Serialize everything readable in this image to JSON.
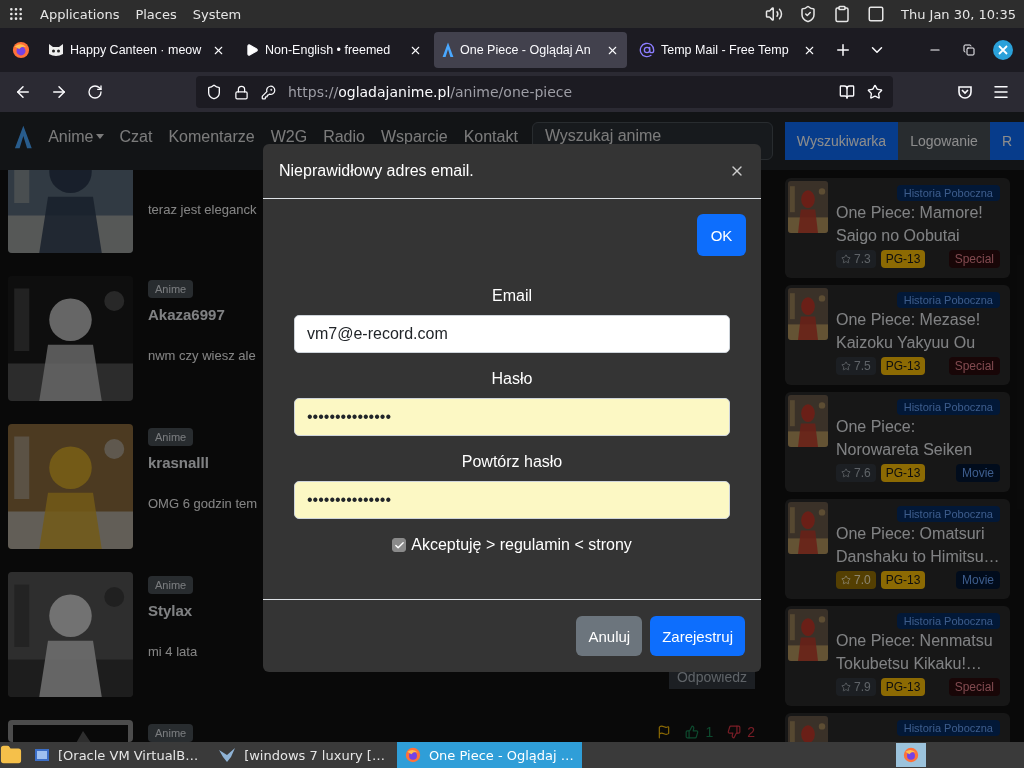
{
  "system_bar": {
    "menus": [
      "Applications",
      "Places",
      "System"
    ],
    "clock": "Thu Jan 30, 10:35"
  },
  "browser": {
    "tabs": [
      {
        "title": "Happy Canteen · meow",
        "selected": false
      },
      {
        "title": "Non-English • freemed",
        "selected": false
      },
      {
        "title": "One Piece - Oglądaj An",
        "selected": true
      },
      {
        "title": "Temp Mail - Free Temp",
        "selected": false
      }
    ],
    "url": {
      "scheme": "https://",
      "host": "ogladajanime.pl",
      "path": "/anime/one-piece"
    }
  },
  "site": {
    "nav": [
      {
        "label": "Anime",
        "dropdown": true
      },
      {
        "label": "Czat",
        "dropdown": false
      },
      {
        "label": "Komentarze",
        "dropdown": false
      },
      {
        "label": "W2G",
        "dropdown": false
      },
      {
        "label": "Radio",
        "dropdown": false
      },
      {
        "label": "Wsparcie",
        "dropdown": false
      },
      {
        "label": "Kontakt",
        "dropdown": false
      }
    ],
    "search": {
      "placeholder": "Wyszukaj anime"
    },
    "nav_buttons": [
      {
        "label": "Wyszukiwarka",
        "kind": "primary"
      },
      {
        "label": "Logowanie",
        "kind": "secondary"
      },
      {
        "label": "R",
        "kind": "primary"
      }
    ],
    "comments": [
      {
        "text": "teraz jest eleganck"
      },
      {
        "badge": "Anime",
        "user": "Akaza6997",
        "text": "nwm czy wiesz ale"
      },
      {
        "badge": "Anime",
        "user": "krasnalll",
        "text": "OMG 6 godzin tem"
      },
      {
        "badge": "Anime",
        "user": "Stylax",
        "text": "mi 4 lata",
        "reply": "Odpowiedz"
      },
      {
        "badge": "Anime",
        "reactions": [
          {
            "kind": "flag"
          },
          {
            "kind": "up",
            "count": "1"
          },
          {
            "kind": "down",
            "count": "2"
          }
        ]
      }
    ],
    "related": [
      {
        "badge": "Historia Poboczna",
        "title": "One Piece: Mamore! Saigo no Oobutai",
        "rating": "7.3",
        "rating_highlight": false,
        "age": "PG-13",
        "type": "Special",
        "kind": "special"
      },
      {
        "badge": "Historia Poboczna",
        "title": "One Piece: Mezase! Kaizoku Yakyuu Ou",
        "rating": "7.5",
        "rating_highlight": false,
        "age": "PG-13",
        "type": "Special",
        "kind": "special"
      },
      {
        "badge": "Historia Poboczna",
        "title": "One Piece: Norowareta Seiken",
        "rating": "7.6",
        "rating_highlight": false,
        "age": "PG-13",
        "type": "Movie",
        "kind": "movie"
      },
      {
        "badge": "Historia Poboczna",
        "title": "One Piece: Omatsuri Danshaku to Himitsu…",
        "rating": "7.0",
        "rating_highlight": true,
        "age": "PG-13",
        "type": "Movie",
        "kind": "movie"
      },
      {
        "badge": "Historia Poboczna",
        "title": "One Piece: Nenmatsu Tokubetsu Kikaku!…",
        "rating": "7.9",
        "rating_highlight": false,
        "age": "PG-13",
        "type": "Special",
        "kind": "special"
      },
      {
        "badge": "Historia Poboczna"
      }
    ]
  },
  "modal": {
    "title": "Nieprawidłowy adres email.",
    "ok": "OK",
    "fields": [
      {
        "label": "Email",
        "value": "vm7@e-record.com",
        "autofilled": false
      },
      {
        "label": "Hasło",
        "value": "•••••••••••••••",
        "autofilled": true
      },
      {
        "label": "Powtórz hasło",
        "value": "•••••••••••••••",
        "autofilled": true
      }
    ],
    "accept": {
      "label": "Akceptuję > regulamin < strony",
      "checked": true
    },
    "buttons": [
      {
        "label": "Anuluj",
        "kind": "secondary"
      },
      {
        "label": "Zarejestruj",
        "kind": "primary"
      }
    ]
  },
  "taskbar": {
    "items": [
      {
        "label": "[Oracle VM VirtualB…",
        "selected": false
      },
      {
        "label": "[windows 7 luxury […",
        "selected": false
      },
      {
        "label": "One Piece - Oglądaj …",
        "selected": true
      }
    ]
  }
}
